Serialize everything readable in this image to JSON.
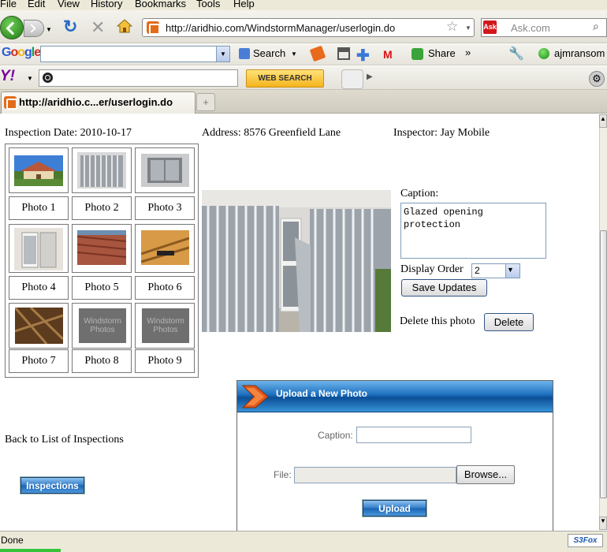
{
  "menubar": {
    "items": [
      "File",
      "Edit",
      "View",
      "History",
      "Bookmarks",
      "Tools",
      "Help"
    ]
  },
  "nav": {
    "url": "http://aridhio.com/WindstormManager/userlogin.do",
    "search_placeholder": "Ask.com",
    "search_provider": "Ask"
  },
  "google_bar": {
    "logo": "Google",
    "search_label": "Search",
    "share_label": "Share",
    "more": "»",
    "account": "ajmransom"
  },
  "yahoo_bar": {
    "logo": "Y!",
    "web_search_label": "WEB SEARCH"
  },
  "tab": {
    "title": "http://aridhio.c...er/userlogin.do",
    "new_tab": "+"
  },
  "inspection": {
    "date_label": "Inspection Date: 2010-10-17",
    "address_label": "Address: 8576 Greenfield Lane",
    "inspector_label": "Inspector: Jay Mobile"
  },
  "photos": [
    {
      "label": "Photo 1",
      "kind": "house"
    },
    {
      "label": "Photo 2",
      "kind": "shutters"
    },
    {
      "label": "Photo 3",
      "kind": "window"
    },
    {
      "label": "Photo 4",
      "kind": "door"
    },
    {
      "label": "Photo 5",
      "kind": "roof-tile"
    },
    {
      "label": "Photo 6",
      "kind": "attic"
    },
    {
      "label": "Photo 7",
      "kind": "rafters"
    },
    {
      "label": "Photo 8",
      "kind": "placeholder",
      "placeholder_text": "Windstorm Photos"
    },
    {
      "label": "Photo 9",
      "kind": "placeholder",
      "placeholder_text": "Windstorm Photos"
    }
  ],
  "editor": {
    "caption_label": "Caption:",
    "caption_value": "Glazed opening\nprotection",
    "display_order_label": "Display Order",
    "display_order_value": "2",
    "save_label": "Save Updates",
    "delete_text": "Delete this photo",
    "delete_label": "Delete"
  },
  "back_link": "Back to List of Inspections",
  "inspections_button": "Inspections",
  "upload": {
    "title": "Upload a New Photo",
    "caption_label": "Caption:",
    "file_label": "File:",
    "browse_label": "Browse...",
    "upload_label": "Upload"
  },
  "status": {
    "text": "Done",
    "addon": "S3Fox"
  },
  "colors": {
    "accent_blue": "#1d6fbe",
    "upload_chevron": "#e2581b"
  }
}
